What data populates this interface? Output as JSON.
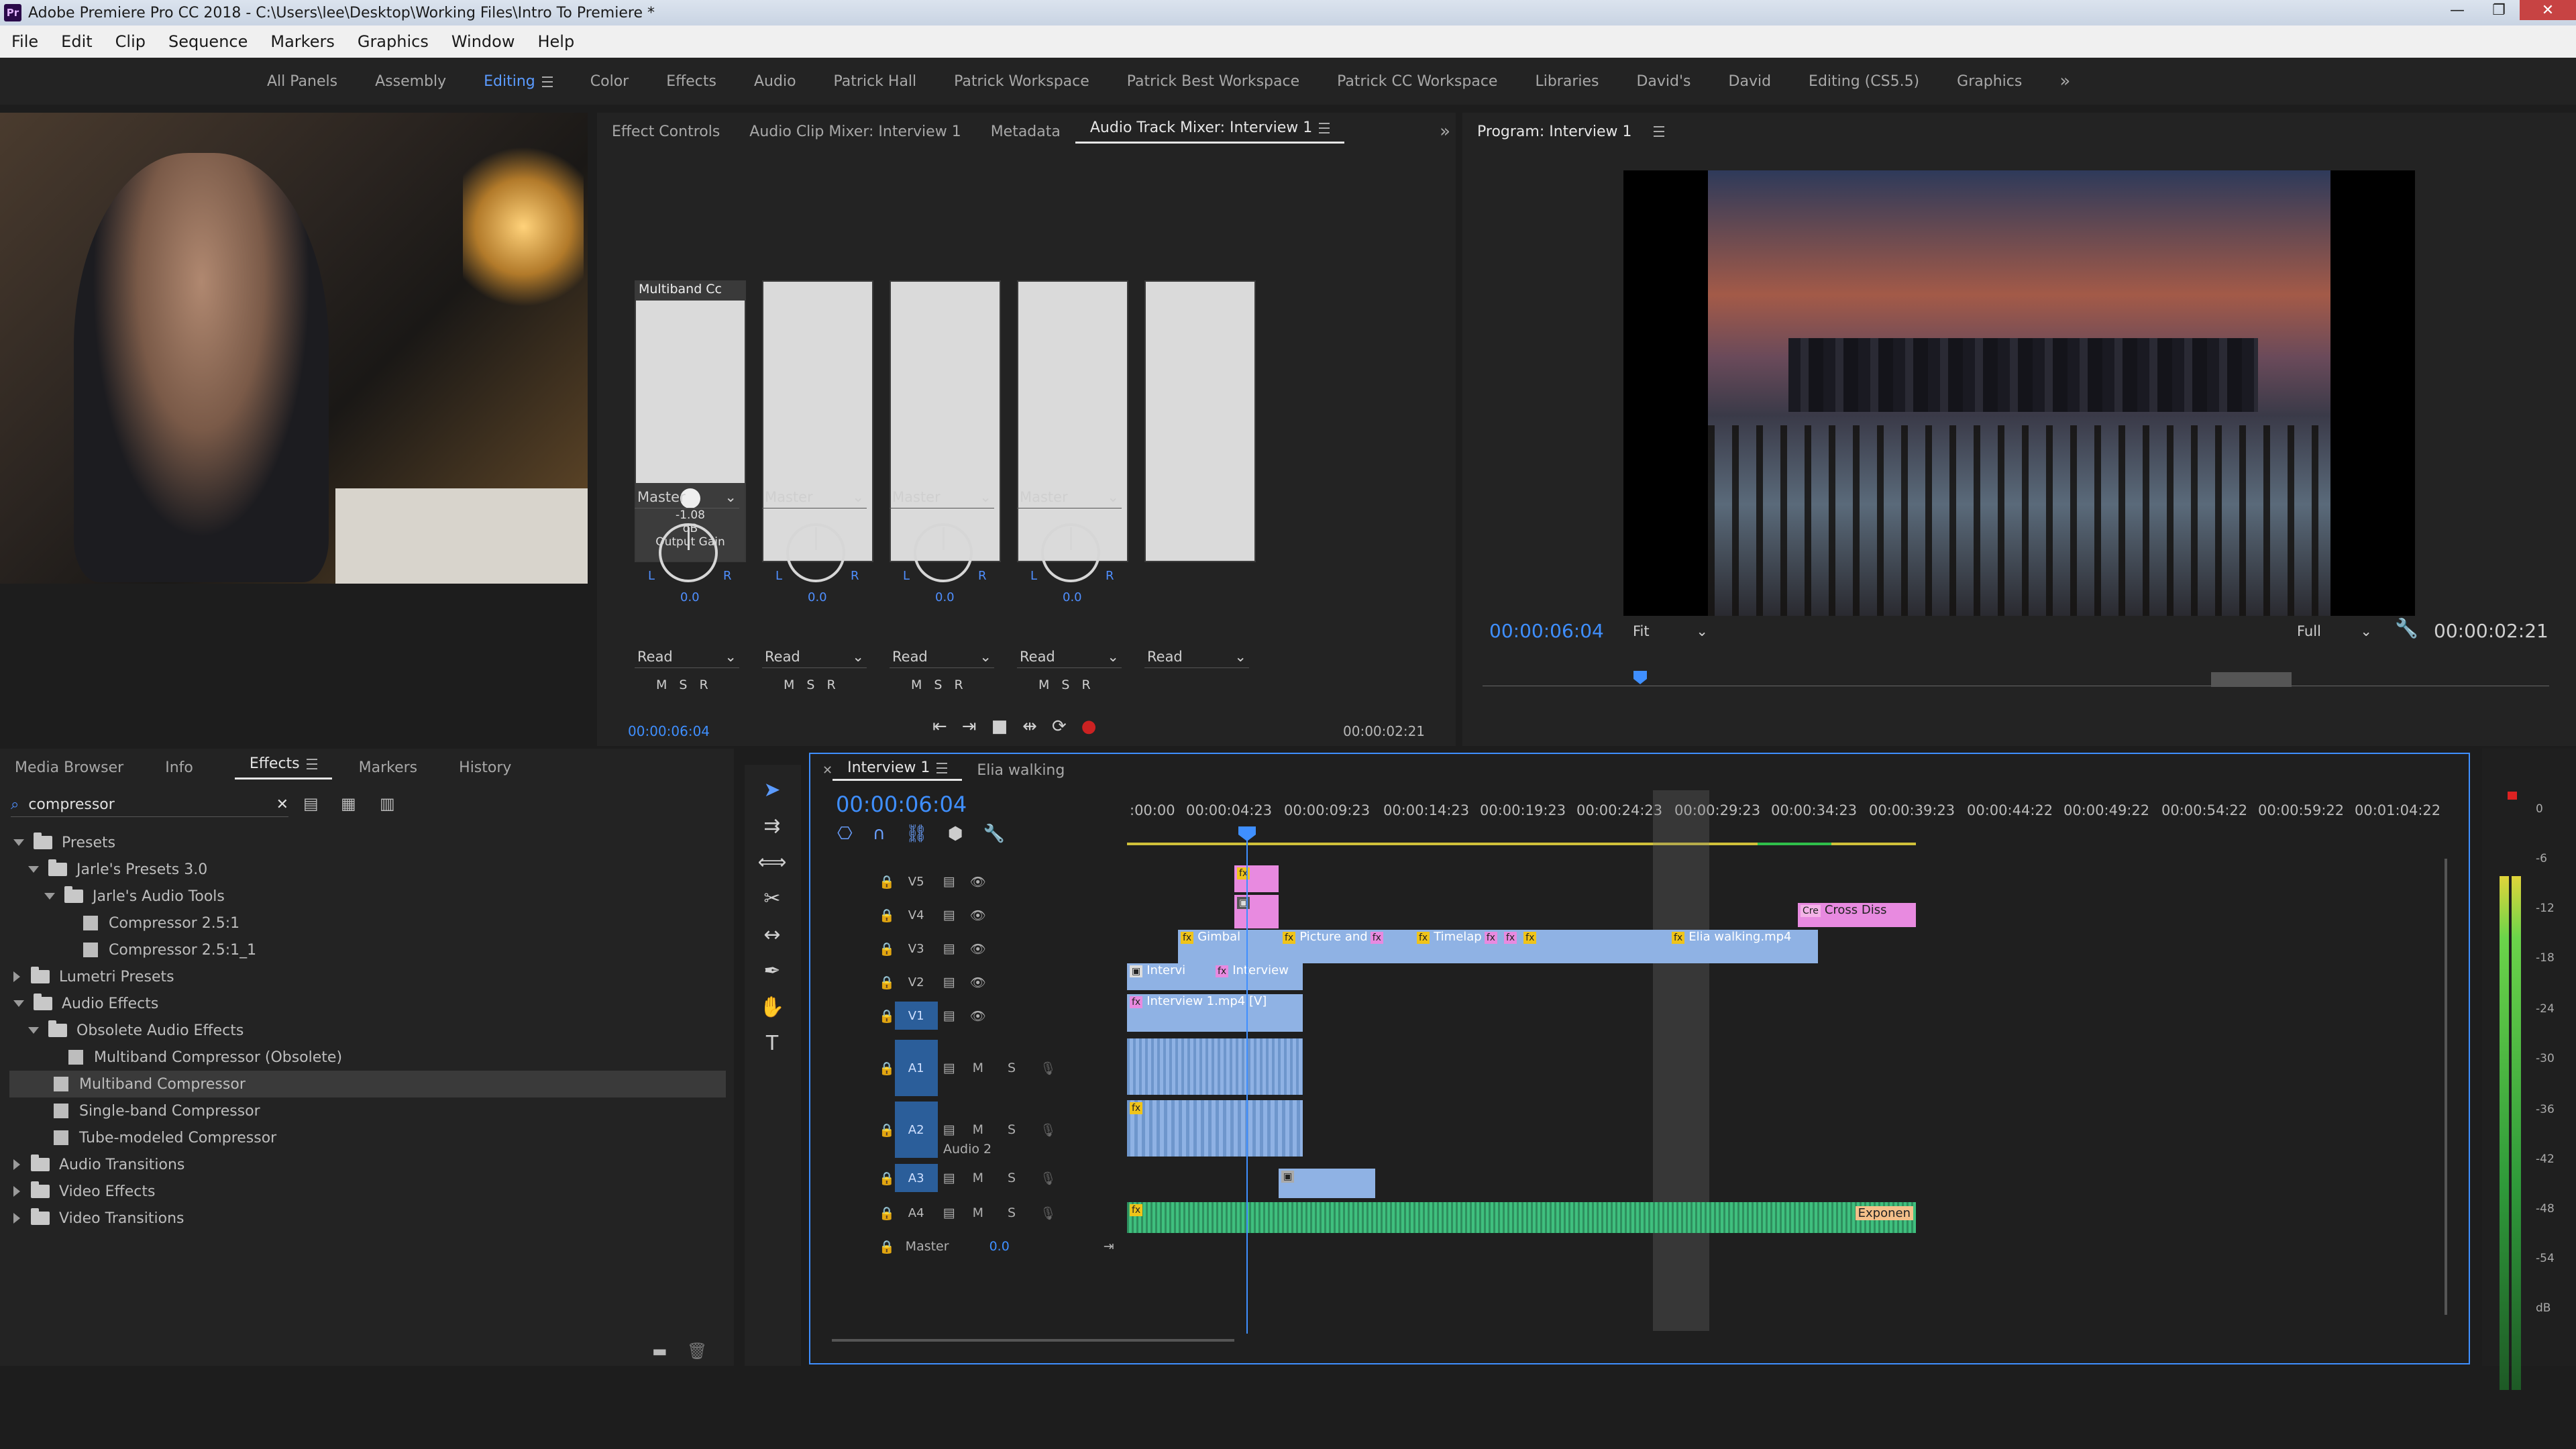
{
  "window": {
    "title": "Adobe Premiere Pro CC 2018 - C:\\Users\\lee\\Desktop\\Working Files\\Intro To Premiere *",
    "logo": "Pr"
  },
  "menu": [
    "File",
    "Edit",
    "Clip",
    "Sequence",
    "Markers",
    "Graphics",
    "Window",
    "Help"
  ],
  "workspaces": [
    "All Panels",
    "Assembly",
    "Editing",
    "Color",
    "Effects",
    "Audio",
    "Patrick Hall",
    "Patrick Workspace",
    "Patrick Best Workspace",
    "Patrick CC Workspace",
    "Libraries",
    "David's",
    "David",
    "Editing (CS5.5)",
    "Graphics"
  ],
  "active_workspace": "Editing",
  "mixer": {
    "tabs": [
      "Effect Controls",
      "Audio Clip Mixer: Interview 1",
      "Metadata",
      "Audio Track Mixer: Interview 1"
    ],
    "effect_name": "Multiband Cc",
    "gain_value": "-1.08",
    "gain_unit": "dB",
    "gain_param": "Output Gain",
    "output": "Master",
    "pan": "0.0",
    "mode": "Read",
    "l": "L",
    "r": "R",
    "time_left": "00:00:06:04",
    "time_right": "00:00:02:21",
    "msr": "MSR"
  },
  "program": {
    "title": "Program: Interview 1",
    "timecode": "00:00:06:04",
    "fit": "Fit",
    "quality": "Full",
    "duration": "00:00:02:21"
  },
  "effects_panel": {
    "tabs": [
      "Media Browser",
      "Info",
      "Effects",
      "Markers",
      "History"
    ],
    "search": "compressor",
    "tree": [
      {
        "label": "Presets",
        "depth": 0,
        "type": "folder",
        "open": true
      },
      {
        "label": "Jarle's Presets 3.0",
        "depth": 1,
        "type": "folder",
        "open": true
      },
      {
        "label": "Jarle's Audio Tools",
        "depth": 2,
        "type": "folder",
        "open": true
      },
      {
        "label": "Compressor 2.5:1",
        "depth": 3,
        "type": "preset"
      },
      {
        "label": "Compressor 2.5:1_1",
        "depth": 3,
        "type": "preset"
      },
      {
        "label": "Lumetri Presets",
        "depth": 0,
        "type": "folder",
        "open": false
      },
      {
        "label": "Audio Effects",
        "depth": 0,
        "type": "folder",
        "open": true
      },
      {
        "label": "Obsolete Audio Effects",
        "depth": 1,
        "type": "folder",
        "open": true
      },
      {
        "label": "Multiband Compressor (Obsolete)",
        "depth": 2,
        "type": "preset"
      },
      {
        "label": "Multiband Compressor",
        "depth": 1,
        "type": "preset",
        "selected": true
      },
      {
        "label": "Single-band Compressor",
        "depth": 1,
        "type": "preset"
      },
      {
        "label": "Tube-modeled Compressor",
        "depth": 1,
        "type": "preset"
      },
      {
        "label": "Audio Transitions",
        "depth": 0,
        "type": "folder",
        "open": false
      },
      {
        "label": "Video Effects",
        "depth": 0,
        "type": "folder",
        "open": false
      },
      {
        "label": "Video Transitions",
        "depth": 0,
        "type": "folder",
        "open": false
      }
    ]
  },
  "timeline": {
    "tabs": [
      "Interview 1",
      "Elia walking"
    ],
    "timecode": "00:00:06:04",
    "ruler": [
      ":00:00",
      "00:00:04:23",
      "00:00:09:23",
      "00:00:14:23",
      "00:00:19:23",
      "00:00:24:23",
      "00:00:29:23",
      "00:00:34:23",
      "00:00:39:23",
      "00:00:44:22",
      "00:00:49:22",
      "00:00:54:22",
      "00:00:59:22",
      "00:01:04:22"
    ],
    "video_tracks": [
      "V5",
      "V4",
      "V3",
      "V2",
      "V1"
    ],
    "audio_tracks": [
      "A1",
      "A2",
      "A3",
      "A4"
    ],
    "audio2_name": "Audio 2",
    "master": "Master",
    "master_value": "0.0",
    "m": "M",
    "s": "S",
    "clips": {
      "gimbal": "Gimbal",
      "picture": "Picture and",
      "timelapse": "Timelap",
      "elia": "Elia walking.mp4",
      "interview_a": "Intervi",
      "interview_b": "Interview",
      "interview_v1": "Interview 1.mp4 [V]",
      "cross": "Cross Diss",
      "cre": "Cre",
      "exponential": "Exponen"
    },
    "meter_scale": [
      "0",
      "-6",
      "-12",
      "-18",
      "-24",
      "-30",
      "-36",
      "-42",
      "-48",
      "-54",
      "dB"
    ]
  },
  "colors": {
    "accent": "#3f8fff",
    "clip_video": "#8fb2e4",
    "clip_fx": "#e88ae0",
    "clip_audio": "#3a9a6a"
  }
}
